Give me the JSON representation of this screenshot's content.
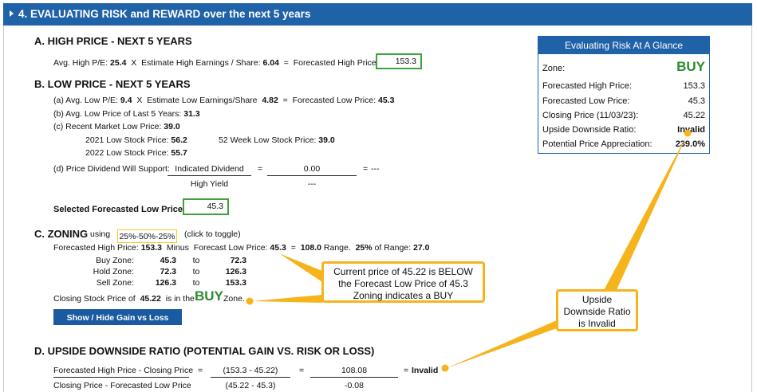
{
  "header": {
    "title": "4. EVALUATING RISK and REWARD over the next 5 years"
  },
  "sectionA": {
    "title": "A. HIGH PRICE - NEXT 5 YEARS",
    "avg_pe_label": "Avg. High P/E:",
    "avg_pe_value": "25.4",
    "times": "X",
    "eps_label": "Estimate High Earnings / Share:",
    "eps_value": "6.04",
    "equals": "=",
    "forecast_label": "Forecasted High Price:",
    "forecast_value": "153.3"
  },
  "sectionB": {
    "title": "B. LOW PRICE - NEXT 5 YEARS",
    "a_label": "(a) Avg. Low P/E:",
    "a_pe": "9.4",
    "a_times": "X",
    "a_eps_label": "Estimate Low Earnings/Share",
    "a_eps": "4.82",
    "a_eq": "=",
    "a_fcst_label": "Forecasted Low Price:",
    "a_fcst": "45.3",
    "b_label": "(b) Avg. Low Price of Last 5 Years:",
    "b_value": "31.3",
    "c_label": "(c) Recent Market Low Price:",
    "c_value": "39.0",
    "low2021_label": "2021 Low Stock Price:",
    "low2021_value": "56.2",
    "low52_label": "52 Week Low Stock Price:",
    "low52_value": "39.0",
    "low2022_label": "2022 Low Stock Price:",
    "low2022_value": "55.7",
    "d_label": "(d) Price Dividend Will Support:",
    "d_num_label": "Indicated Dividend",
    "d_den_label": "High Yield",
    "d_eq1": "=",
    "d_num_value": "0.00",
    "d_den_value": "---",
    "d_eq2": "=",
    "d_result": "---",
    "selected_label": "Selected Forecasted Low Price:",
    "selected_value": "45.3"
  },
  "sectionC": {
    "title": "C. ZONING",
    "using": "using",
    "toggle_value": "25%-50%-25%",
    "toggle_hint": "(click to toggle)",
    "line_high_label": "Forecasted High Price:",
    "line_high_value": "153.3",
    "minus": "Minus",
    "line_low_label": "Forecast Low Price:",
    "line_low_value": "45.3",
    "eq": "=",
    "range_value": "108.0",
    "range_label": "Range.",
    "pct_value": "25%",
    "pct_label": "of Range:",
    "pct_result": "27.0",
    "zones": [
      {
        "label": "Buy Zone:",
        "from": "45.3",
        "to_word": "to",
        "to": "72.3"
      },
      {
        "label": "Hold Zone:",
        "from": "72.3",
        "to_word": "to",
        "to": "126.3"
      },
      {
        "label": "Sell Zone:",
        "from": "126.3",
        "to_word": "to",
        "to": "153.3"
      }
    ],
    "closing_label": "Closing Stock Price of",
    "closing_value": "45.22",
    "is_in_the": "is in the",
    "zone_value": "BUY",
    "zone_word": "Zone.",
    "chart_button": "Show / Hide Gain vs Loss Chart"
  },
  "sectionD": {
    "title": "D. UPSIDE DOWNSIDE RATIO (POTENTIAL GAIN VS. RISK OR LOSS)",
    "num_label": "Forecasted High Price  -  Closing Price",
    "den_label": "Closing Price  -  Forecasted Low Price",
    "eq1": "=",
    "num_expr": "(153.3  -  45.22)",
    "den_expr": "(45.22  -  45.3)",
    "eq2": "=",
    "num_val": "108.08",
    "den_val": "-0.08",
    "eq3": "=",
    "result": "Invalid"
  },
  "glance": {
    "title": "Evaluating Risk At A Glance",
    "zone_label": "Zone:",
    "zone_value": "BUY",
    "rows": [
      {
        "label": "Forecasted High Price:",
        "value": "153.3"
      },
      {
        "label": "Forecasted Low Price:",
        "value": "45.3"
      },
      {
        "label": "Closing Price (11/03/23):",
        "value": "45.22"
      },
      {
        "label": "Upside Downside Ratio:",
        "value": "Invalid"
      },
      {
        "label": "Potential Price Appreciation:",
        "value": "239.0%"
      }
    ]
  },
  "callouts": {
    "zoning_lines": [
      "Current price of 45.22 is BELOW",
      "the Forecast Low Price of 45.3",
      "Zoning indicates a BUY"
    ],
    "ratio_lines": [
      "Upside",
      "Downside Ratio",
      "is Invalid"
    ]
  },
  "colors": {
    "header": "#1f62a8",
    "buy_green": "#2e8b2e",
    "callout_orange": "#f5b31c",
    "box_green": "#3aa33a",
    "toggle_yellow": "#f0d020"
  }
}
